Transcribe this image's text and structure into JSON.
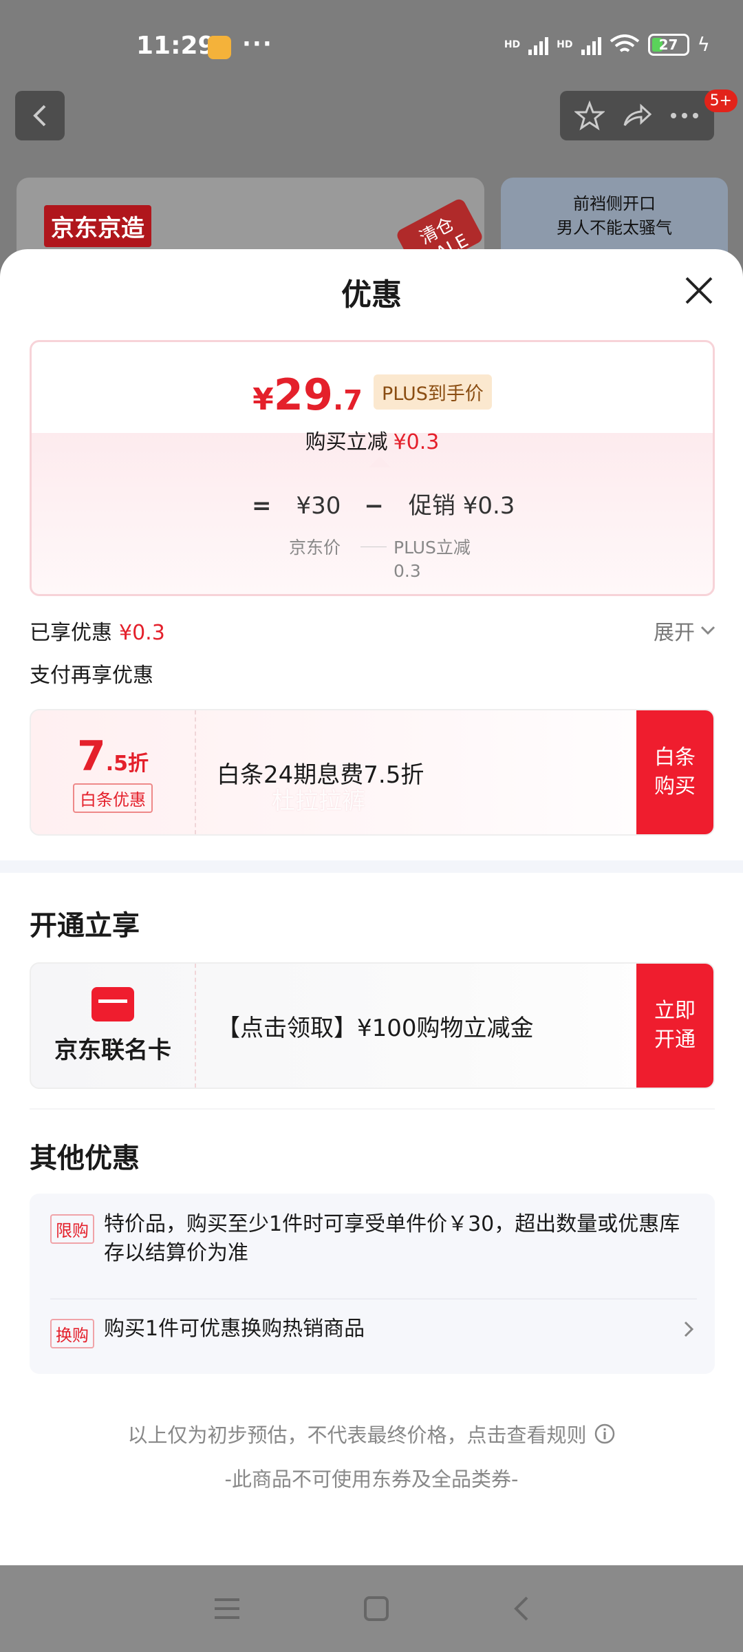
{
  "status_bar": {
    "time": "11:29",
    "dots": "···",
    "signal1_label": "HD",
    "signal2_label": "HD",
    "wifi_sub": "6",
    "battery": "27"
  },
  "background": {
    "brand_label": "京东京造",
    "sale_tag": "清仓 SALE",
    "side_banner_line1": "前裆侧开口",
    "side_banner_line2": "男人不能太骚气",
    "badge": "5+"
  },
  "sheet": {
    "title": "优惠",
    "price": {
      "yen": "¥",
      "int": "29",
      "dec": ".7",
      "plus_tag": "PLUS到手价",
      "instant_label": "购买立减",
      "instant_value": "¥0.3",
      "eq": "=",
      "base_price": "¥30",
      "minus": "−",
      "promo_label": "促销 ¥0.3",
      "base_caption": "京东价",
      "promo_caption_1": "PLUS立减",
      "promo_caption_2": "0.3"
    },
    "enjoyed_label": "已享优惠",
    "enjoyed_value": "¥0.3",
    "expand_label": "展开",
    "pay_title": "支付再享优惠",
    "baitiao": {
      "discount_big": "7",
      "discount_small": ".5折",
      "tag": "白条优惠",
      "desc": "白条24期息费7.5折",
      "watermark": "杜拉拉裤",
      "button_line1": "白条",
      "button_line2": "购买"
    },
    "open_title": "开通立享",
    "cobrand": {
      "name": "京东联名卡",
      "desc": "【点击领取】¥100购物立减金",
      "button_line1": "立即",
      "button_line2": "开通"
    },
    "other_title": "其他优惠",
    "rules": [
      {
        "tag": "限购",
        "text": "特价品，购买至少1件时可享受单件价￥30，超出数量或优惠库存以结算价为准"
      },
      {
        "tag": "换购",
        "text": "购买1件可优惠换购热销商品"
      }
    ],
    "footer_note": "以上仅为初步预估，不代表最终价格，点击查看规则",
    "footer_coupon": "-此商品不可使用东券及全品类券-"
  },
  "colors": {
    "accent_red": "#e4202b",
    "button_red": "#ef1d2e"
  }
}
